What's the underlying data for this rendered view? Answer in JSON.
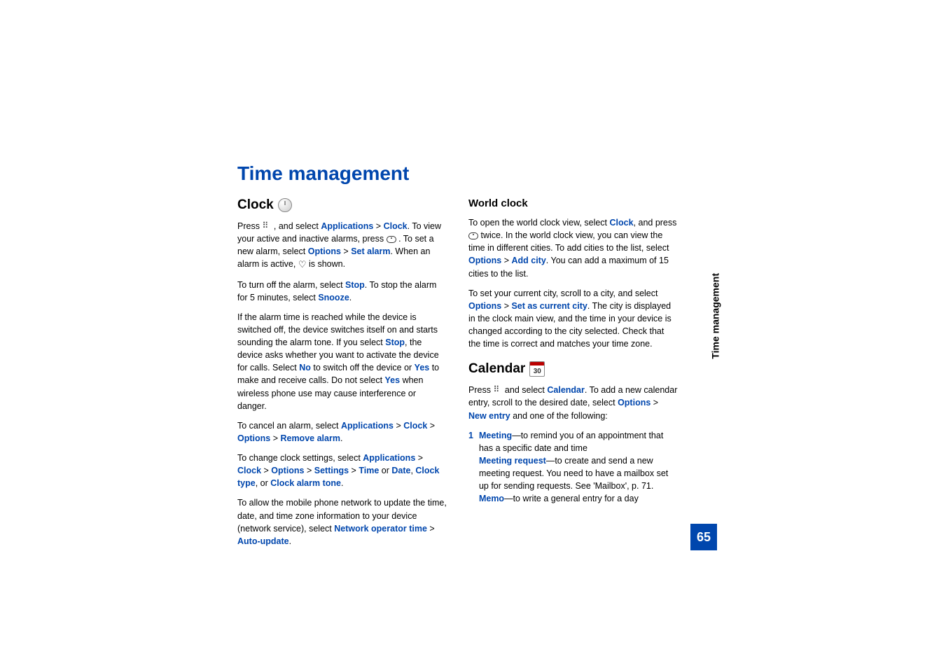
{
  "title": "Time management",
  "sideTab": "Time management",
  "pageNumber": "65",
  "clock": {
    "heading": "Clock",
    "p1a": "Press ",
    "p1b": " , and select ",
    "link_applications": "Applications",
    "gt": " > ",
    "link_clock": "Clock",
    "p1c": ". To view your active and inactive alarms, press ",
    "p1d": " . To set a new alarm, select ",
    "link_options": "Options",
    "link_setalarm": "Set alarm",
    "p1e": ". When an alarm is active, ",
    "p1f": " is shown.",
    "p2a": "To turn off the alarm, select ",
    "link_stop": "Stop",
    "p2b": ". To stop the alarm for 5 minutes, select ",
    "link_snooze": "Snooze",
    "p2c": ".",
    "p3a": "If the alarm time is reached while the device is switched off, the device switches itself on and starts sounding the alarm tone. If you select ",
    "p3b": ", the device asks whether you want to activate the device for calls. Select ",
    "link_no": "No",
    "p3c": " to switch off the device or ",
    "link_yes": "Yes",
    "p3d": " to make and receive calls. Do not select ",
    "p3e": " when wireless phone use may cause interference or danger.",
    "p4a": "To cancel an alarm, select ",
    "link_removealarm": "Remove alarm",
    "p4b": ".",
    "p5a": "To change clock settings, select ",
    "link_settings": "Settings",
    "link_time": "Time",
    "or": " or ",
    "link_date": "Date",
    "comma": ", ",
    "link_clocktype": "Clock type",
    "commaor": ", or ",
    "link_clockalarmtone": "Clock alarm tone",
    "p5b": ".",
    "p6a": "To allow the mobile phone network to update the time, date, and time zone information to your device (network service), select ",
    "link_networkoperatortime": "Network operator time",
    "link_autoupdate": "Auto-update",
    "p6b": "."
  },
  "worldclock": {
    "heading": "World clock",
    "p1a": "To open the world clock view, select ",
    "link_clock": "Clock",
    "p1b": ", and press ",
    "p1c": " twice. In the world clock view, you can view the time in different cities. To add cities to the list, select ",
    "link_options": "Options",
    "gt": " > ",
    "link_addcity": "Add city",
    "p1d": ". You can add a maximum of 15 cities to the list.",
    "p2a": "To set your current city, scroll to a city, and select ",
    "link_setascurrentcity": "Set as current city",
    "p2b": ". The city is displayed in the clock main view, and the time in your device is changed according to the city selected. Check that the time is correct and matches your time zone."
  },
  "calendar": {
    "heading": "Calendar",
    "iconDay": "30",
    "p1a": "Press ",
    "p1b": " and select ",
    "link_calendar": "Calendar",
    "p1c": ". To add a new calendar entry, scroll to the desired date, select ",
    "link_options": "Options",
    "gt": " > ",
    "link_newentry": "New entry",
    "p1d": " and one of the following:",
    "list_num": "1",
    "link_meeting": "Meeting",
    "list1a": "—to remind you of an appointment that has a specific date and time",
    "link_meetingrequest": "Meeting request",
    "list1b": "—to create and send a new meeting request. You need to have a mailbox set up for sending requests. See 'Mailbox', p. 71.",
    "link_memo": "Memo",
    "list1c": "—to write a general entry for a day"
  }
}
